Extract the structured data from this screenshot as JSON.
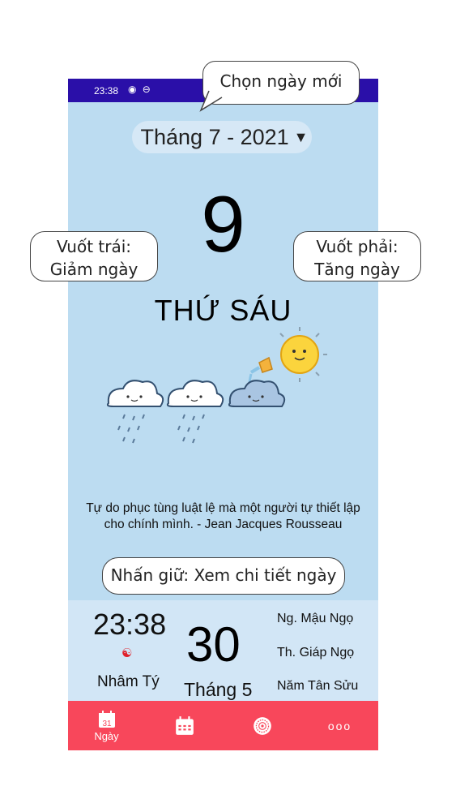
{
  "status_bar": {
    "time": "23:38",
    "icons": "◉ ⊖"
  },
  "header": {
    "month_label": "Tháng 7 - 2021",
    "caret": "▼"
  },
  "day": {
    "number": "9",
    "weekday": "THỨ SÁU"
  },
  "quote": "Tự do phục tùng luật lệ mà một người tự thiết lập cho chính mình. - Jean Jacques Rousseau",
  "lunar_panel": {
    "clock": "23:38",
    "hour_name": "Nhâm Tý",
    "day": "30",
    "month": "Tháng 5",
    "day_can_chi": "Ng. Mậu Ngọ",
    "month_can_chi": "Th. Giáp Ngọ",
    "year_can_chi": "Năm Tân Sửu"
  },
  "nav": {
    "items": [
      {
        "label": "Ngày",
        "icon": "calendar-day-icon",
        "badge": "31"
      },
      {
        "label": "",
        "icon": "calendar-month-icon"
      },
      {
        "label": "",
        "icon": "compass-icon"
      },
      {
        "label": "",
        "icon": "more-icon",
        "dots": "ooo"
      }
    ]
  },
  "annotations": {
    "new_date": "Chọn ngày mới",
    "swipe_left_1": "Vuốt trái:",
    "swipe_left_2": "Giảm ngày",
    "swipe_right_1": "Vuốt phải:",
    "swipe_right_2": "Tăng ngày",
    "hold": "Nhấn giữ: Xem chi tiết ngày"
  },
  "colors": {
    "status_bar": "#2a0fa8",
    "background": "#bcdcf1",
    "panel": "#d2e6f6",
    "nav_bar": "#f8475b"
  }
}
